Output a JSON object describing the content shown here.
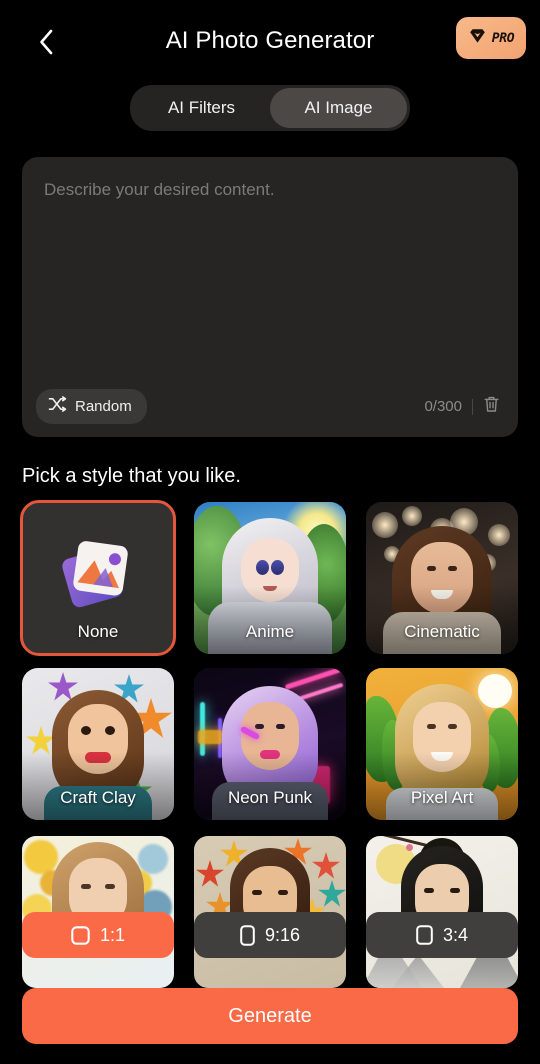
{
  "header": {
    "title": "AI Photo Generator",
    "back_icon": "chevron-left-icon",
    "pro_badge": {
      "label": "PRO",
      "icon": "diamond-heart-icon",
      "color": "#f5ad7c"
    }
  },
  "tabs": {
    "items": [
      {
        "label": "AI Filters",
        "active": false
      },
      {
        "label": "AI Image",
        "active": true
      }
    ]
  },
  "prompt": {
    "placeholder": "Describe your desired content.",
    "value": "",
    "random_button": {
      "label": "Random",
      "icon": "shuffle-icon"
    },
    "counter": "0/300",
    "char_count": 0,
    "char_limit": 300,
    "clear_icon": "trash-icon"
  },
  "styles": {
    "section_title": "Pick a style that you like.",
    "selected": "None",
    "selection_color": "#e4573a",
    "items": [
      {
        "label": "None",
        "thumb": "none-placeholder-icon",
        "selected": true
      },
      {
        "label": "Anime",
        "thumb": "anime-portrait",
        "selected": false
      },
      {
        "label": "Cinematic",
        "thumb": "cinematic-portrait",
        "selected": false
      },
      {
        "label": "Craft Clay",
        "thumb": "craft-clay-portrait",
        "selected": false
      },
      {
        "label": "Neon Punk",
        "thumb": "neon-punk-portrait",
        "selected": false
      },
      {
        "label": "Pixel Art",
        "thumb": "pixel-art-portrait",
        "selected": false
      },
      {
        "label": "",
        "thumb": "watercolor-portrait",
        "selected": false
      },
      {
        "label": "",
        "thumb": "origami-portrait",
        "selected": false
      },
      {
        "label": "",
        "thumb": "ink-painting-portrait",
        "selected": false
      }
    ]
  },
  "ratios": {
    "selected": "1:1",
    "accent": "#fa6a46",
    "items": [
      {
        "label": "1:1",
        "icon": "square-icon",
        "active": true
      },
      {
        "label": "9:16",
        "icon": "portrait-tall-icon",
        "active": false
      },
      {
        "label": "3:4",
        "icon": "portrait-icon",
        "active": false
      }
    ]
  },
  "generate": {
    "label": "Generate",
    "color": "#fa6a46"
  }
}
